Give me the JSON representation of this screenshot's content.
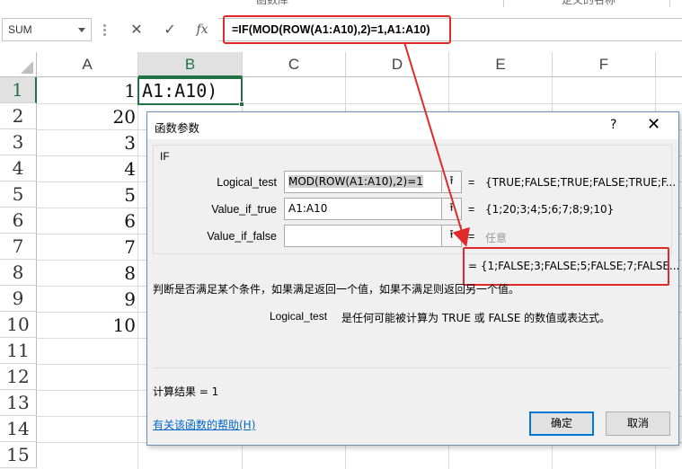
{
  "top_strip": {
    "left_label": "函数库",
    "right_label": "定义的名称"
  },
  "formula_bar": {
    "name_box": "SUM",
    "cancel_glyph": "✕",
    "enter_glyph": "✓",
    "fx_glyph": "fx",
    "formula": "=IF(MOD(ROW(A1:A10),2)=1,A1:A10)"
  },
  "grid": {
    "columns": [
      "A",
      "B",
      "C",
      "D",
      "E",
      "F"
    ],
    "selected_column": "B",
    "rows": [
      "1",
      "2",
      "3",
      "4",
      "5",
      "6",
      "7",
      "8",
      "9",
      "10",
      "11",
      "12",
      "13",
      "14",
      "15"
    ],
    "selected_row": "1",
    "column_a_values": [
      "1",
      "20",
      "3",
      "4",
      "5",
      "6",
      "7",
      "8",
      "9",
      "10"
    ],
    "active_cell_text": "A1:A10)"
  },
  "dialog": {
    "title": "函数参数",
    "help_glyph": "?",
    "close_glyph": "✕",
    "function_name": "IF",
    "args": [
      {
        "label": "Logical_test",
        "value": "MOD(ROW(A1:A10),2)=1",
        "eq": "=",
        "result": "{TRUE;FALSE;TRUE;FALSE;TRUE;F..."
      },
      {
        "label": "Value_if_true",
        "value": "A1:A10",
        "eq": "=",
        "result": "{1;20;3;4;5;6;7;8;9;10}"
      },
      {
        "label": "Value_if_false",
        "value": "",
        "eq": "=",
        "result": "任意"
      }
    ],
    "collapse_glyph": "⭱",
    "formula_result": "= {1;FALSE;3;FALSE;5;FALSE;7;FALSE...",
    "description": "判断是否满足某个条件，如果满足返回一个值，如果不满足则返回另一个值。",
    "arg_desc_name": "Logical_test",
    "arg_desc_text": "是任何可能被计算为 TRUE 或 FALSE 的数值或表达式。",
    "calc_result": "计算结果 =   1",
    "help_link": "有关该函数的帮助(H)",
    "ok_label": "确定",
    "cancel_label": "取消"
  },
  "colors": {
    "excel_green": "#217346",
    "annotation_red": "#e02a2a",
    "link_blue": "#0066cc"
  }
}
